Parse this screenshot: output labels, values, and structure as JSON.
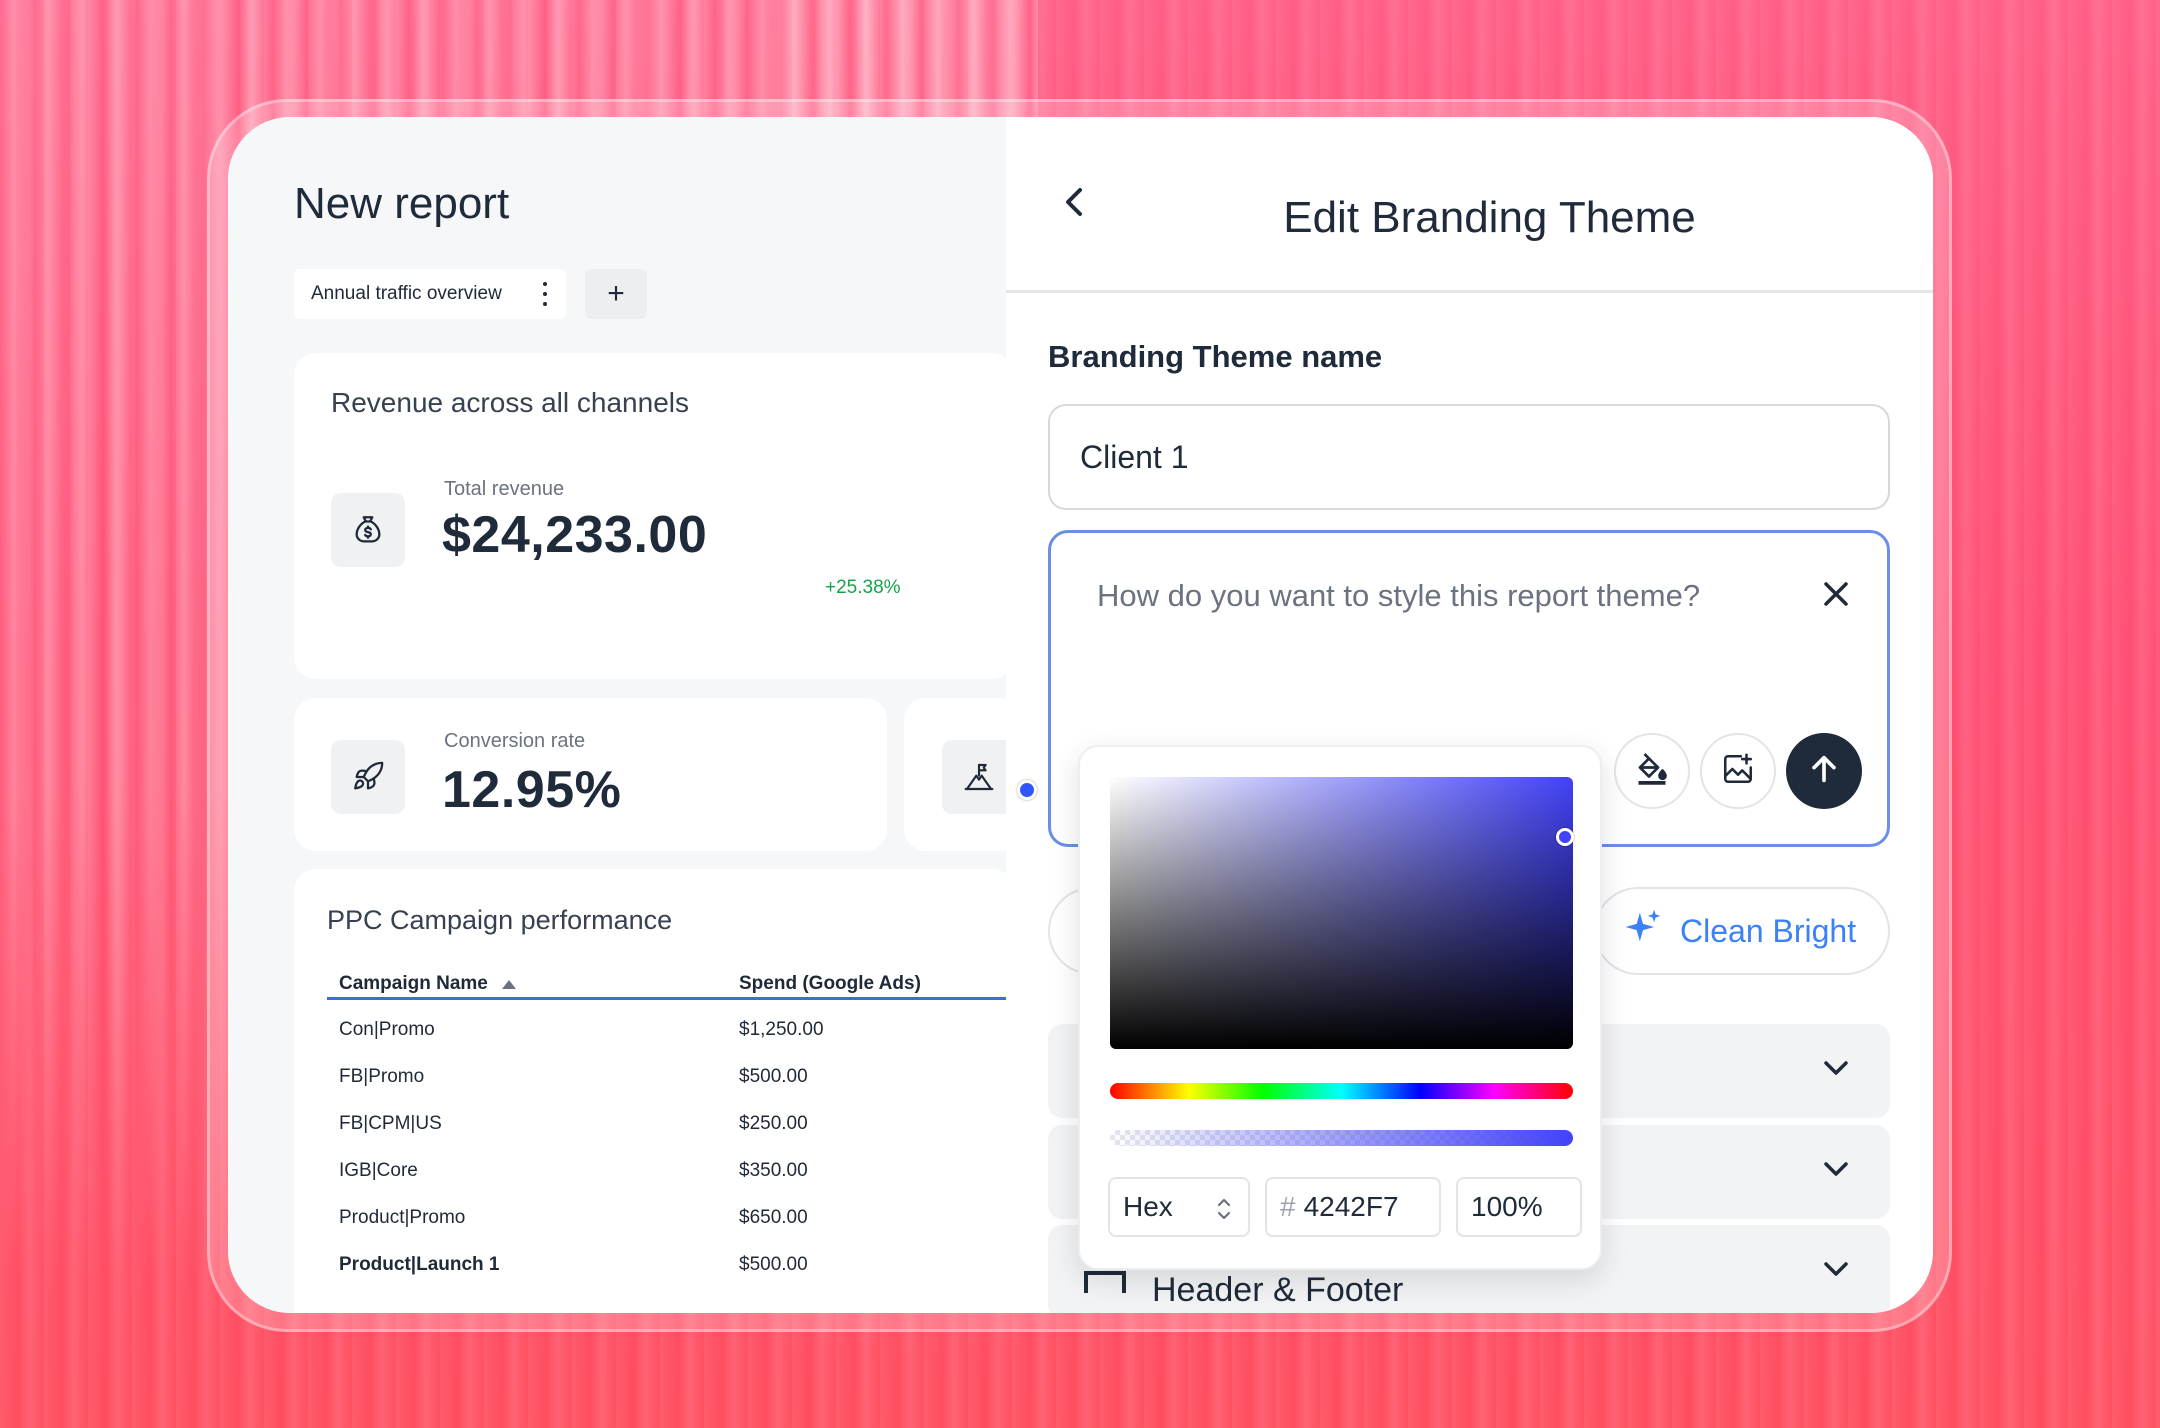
{
  "report": {
    "title": "New report",
    "tab_label": "Annual traffic overview",
    "add_tab": "+",
    "revenue_card": {
      "title": "Revenue across all channels",
      "metric_label": "Total revenue",
      "metric_value": "$24,233.00",
      "delta": "+25.38%"
    },
    "conversion_card": {
      "metric_label": "Conversion rate",
      "metric_value": "12.95%"
    },
    "ppc_table": {
      "title": "PPC Campaign performance",
      "columns": [
        "Campaign Name",
        "Spend (Google Ads)"
      ],
      "rows": [
        [
          "Con|Promo",
          "$1,250.00"
        ],
        [
          "FB|Promo",
          "$500.00"
        ],
        [
          "FB|CPM|US",
          "$250.00"
        ],
        [
          "IGB|Core",
          "$350.00"
        ],
        [
          "Product|Promo",
          "$650.00"
        ],
        [
          "Product|Launch 1",
          "$500.00"
        ]
      ]
    }
  },
  "branding": {
    "title": "Edit Branding Theme",
    "name_label": "Branding Theme name",
    "name_value": "Client 1",
    "prompt_placeholder": "How do you want to style this report theme?",
    "suggestion_chip": "Clean Bright",
    "accordion_partial_label": "Header & Footer"
  },
  "color_picker": {
    "mode": "Hex",
    "hex_value": "4242F7",
    "hash_symbol": "#",
    "alpha": "100%",
    "selected_color": "#4242F7"
  },
  "icons": [
    "money-bag-icon",
    "rocket-icon",
    "mountain-flag-icon",
    "back-chevron-icon",
    "close-icon",
    "paint-bucket-icon",
    "image-add-icon",
    "arrow-up-icon",
    "sparkle-icon",
    "chevron-down-icon",
    "updown-icon",
    "kebab-menu-icon",
    "sort-asc-icon"
  ],
  "colors": {
    "accent_blue": "#3b82f6",
    "focus_border": "#6b8ee8",
    "positive": "#16a34a",
    "dark": "#1f2a3a"
  }
}
